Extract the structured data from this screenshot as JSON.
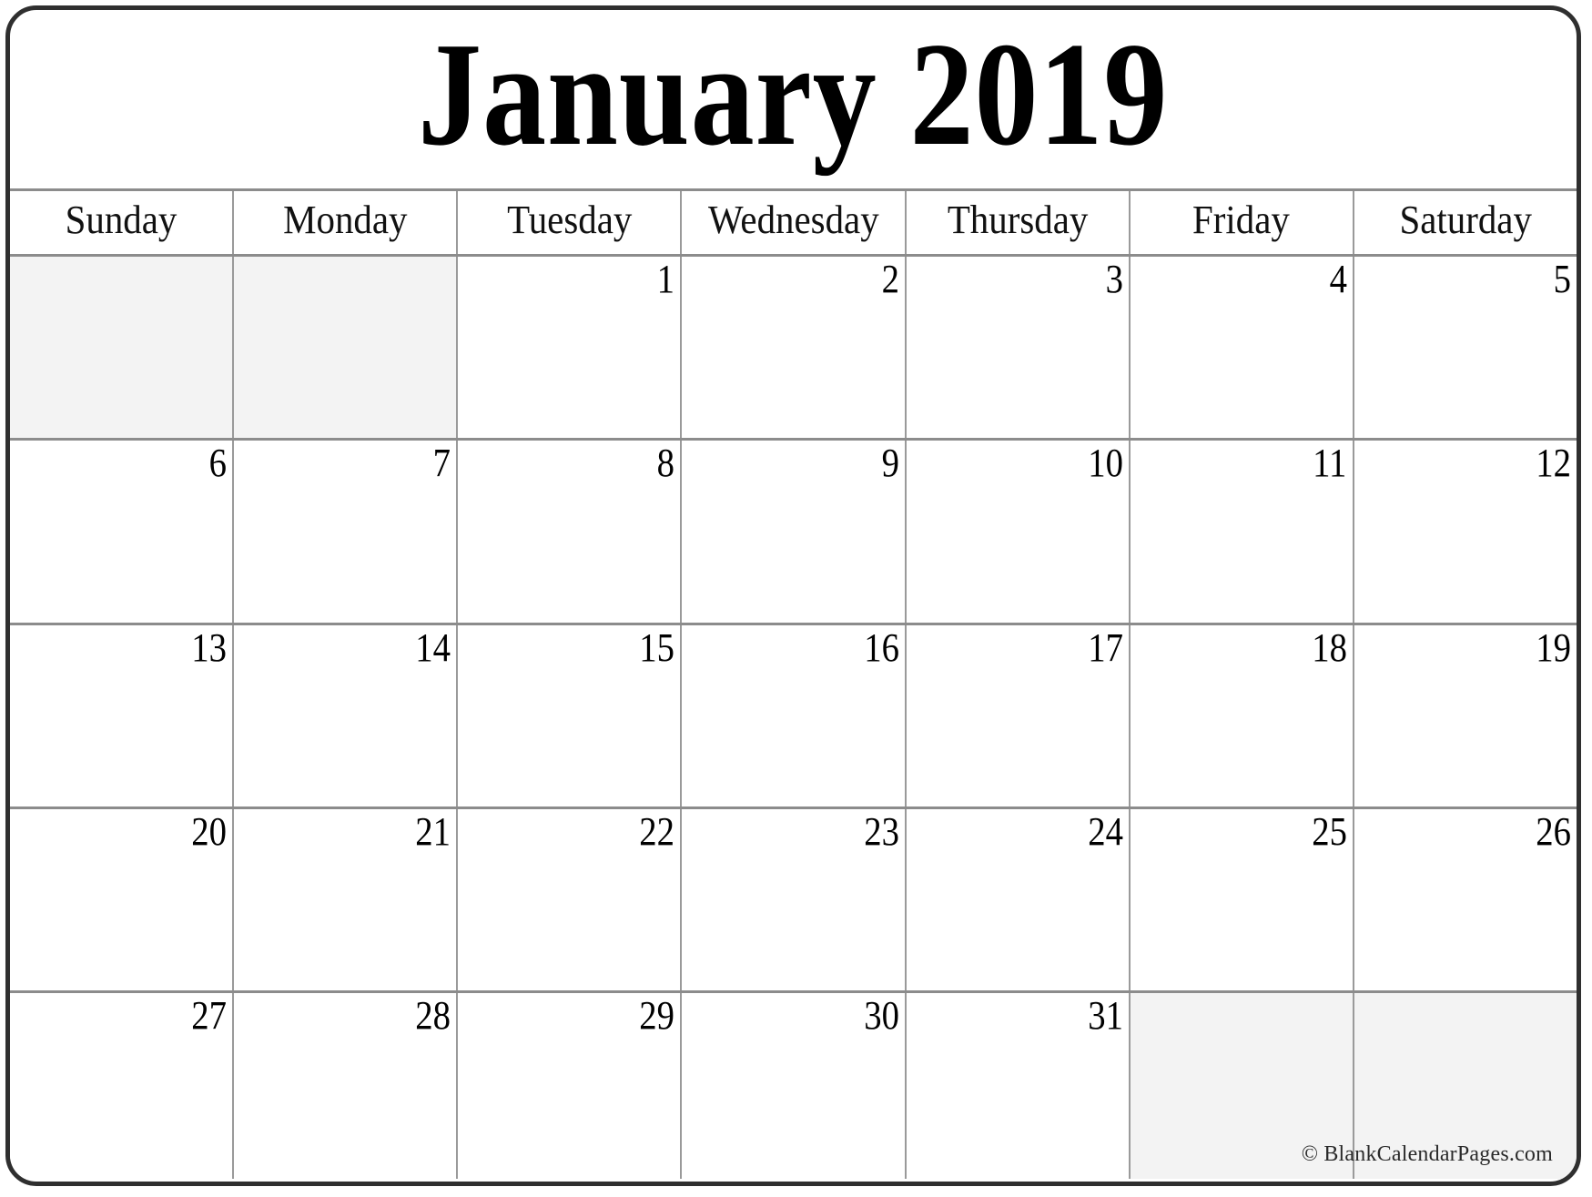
{
  "calendar": {
    "title": "January 2019",
    "month": "January",
    "year": "2019",
    "weekday_headers": [
      "Sunday",
      "Monday",
      "Tuesday",
      "Wednesday",
      "Thursday",
      "Friday",
      "Saturday"
    ],
    "weeks": [
      [
        {
          "day": "",
          "blank": true
        },
        {
          "day": "",
          "blank": true
        },
        {
          "day": "1",
          "blank": false
        },
        {
          "day": "2",
          "blank": false
        },
        {
          "day": "3",
          "blank": false
        },
        {
          "day": "4",
          "blank": false
        },
        {
          "day": "5",
          "blank": false
        }
      ],
      [
        {
          "day": "6",
          "blank": false
        },
        {
          "day": "7",
          "blank": false
        },
        {
          "day": "8",
          "blank": false
        },
        {
          "day": "9",
          "blank": false
        },
        {
          "day": "10",
          "blank": false
        },
        {
          "day": "11",
          "blank": false
        },
        {
          "day": "12",
          "blank": false
        }
      ],
      [
        {
          "day": "13",
          "blank": false
        },
        {
          "day": "14",
          "blank": false
        },
        {
          "day": "15",
          "blank": false
        },
        {
          "day": "16",
          "blank": false
        },
        {
          "day": "17",
          "blank": false
        },
        {
          "day": "18",
          "blank": false
        },
        {
          "day": "19",
          "blank": false
        }
      ],
      [
        {
          "day": "20",
          "blank": false
        },
        {
          "day": "21",
          "blank": false
        },
        {
          "day": "22",
          "blank": false
        },
        {
          "day": "23",
          "blank": false
        },
        {
          "day": "24",
          "blank": false
        },
        {
          "day": "25",
          "blank": false
        },
        {
          "day": "26",
          "blank": false
        }
      ],
      [
        {
          "day": "27",
          "blank": false
        },
        {
          "day": "28",
          "blank": false
        },
        {
          "day": "29",
          "blank": false
        },
        {
          "day": "30",
          "blank": false
        },
        {
          "day": "31",
          "blank": false
        },
        {
          "day": "",
          "blank": true
        },
        {
          "day": "",
          "blank": true
        }
      ]
    ],
    "credit": "© BlankCalendarPages.com",
    "colors": {
      "outer_border": "#2f2f2f",
      "grid_line": "#8c8c8c",
      "cell_divider": "#9a9a9a",
      "blank_cell_fill": "#f3f3f3",
      "text": "#000000",
      "page_background": "#ffffff"
    }
  }
}
